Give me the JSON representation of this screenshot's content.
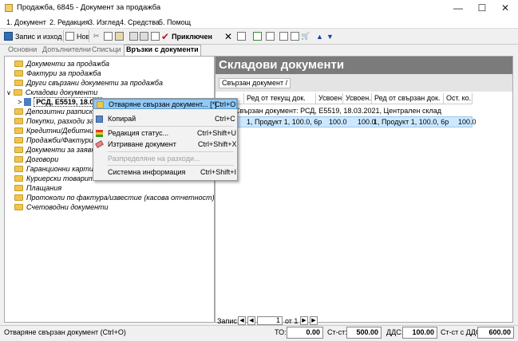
{
  "window": {
    "title": "Продажба, 6845 - Документ за продажба"
  },
  "menubar": {
    "items": [
      "1. Документ",
      "2. Редакция",
      "3. Изглед",
      "4. Средства",
      "5. Помощ"
    ]
  },
  "toolbar": {
    "save_exit": "Запис и изход",
    "new": "Нов",
    "accounted": "Приключен"
  },
  "tabs": [
    "Основни",
    "Допълнителни",
    "Списъци",
    "Връзки с документи"
  ],
  "tree": {
    "items": [
      "Документи за продажба",
      "Фактури за продажба",
      "Други свързани документи за продажба",
      "Складови документи",
      "РСД, Е5519, 18.03.",
      "Депозитни разписки",
      "Покупки, разходи за н",
      "Кредитни/Дебитни и",
      "Продажби/Фактури,",
      "Документи за заявка",
      "Договори",
      "Гаранционни карти",
      "Куриерски товарите",
      "Плащания",
      "Протоколи по фактура/известие (касова отчетност)",
      "Счетоводни документи"
    ]
  },
  "right": {
    "header": "Складови документи",
    "group_chip": "Свързан документ /",
    "columns": [
      "Ред от текущ док.",
      "Усвоен...",
      "Усвоен...",
      "Ред от свързан док.",
      "Ост. ко..."
    ],
    "group_row": "Свързан документ: РСД, Е5519, 18.03.2021, Централен склад",
    "row": [
      "1, Продукт 1, 100.0, 6р",
      "100.0",
      "100.0",
      "1, Продукт 1, 100.0, 6р",
      "100.0"
    ]
  },
  "pager": {
    "label": "Запис:",
    "current": "1",
    "of": "от 1"
  },
  "context_menu": {
    "items": [
      {
        "label": "Отваряне свързан документ... [*]",
        "shortcut": "Ctrl+O"
      },
      {
        "label": "Копирай",
        "shortcut": "Ctrl+C"
      },
      {
        "label": "Редакция статус...",
        "shortcut": "Ctrl+Shift+U"
      },
      {
        "label": "Изтриване документ",
        "shortcut": "Ctrl+Shift+X"
      },
      {
        "label": "Разпределяне на разходи...",
        "shortcut": ""
      },
      {
        "label": "Системна информация",
        "shortcut": "Ctrl+Shift+I"
      }
    ]
  },
  "status": {
    "hint": "Отваряне свързан документ (Ctrl+O)",
    "to_label": "ТО:",
    "to_value": "0.00",
    "st_label": "Ст-ст:",
    "st_value": "500.00",
    "dds_label": "ДДС:",
    "dds_value": "100.00",
    "total_label": "Ст-ст с ДДС:",
    "total_value": "600.00"
  },
  "colors": {
    "header_bg": "#7b7b7b",
    "selection": "#cce8ff",
    "menu_highlight": "#91c9f7"
  }
}
